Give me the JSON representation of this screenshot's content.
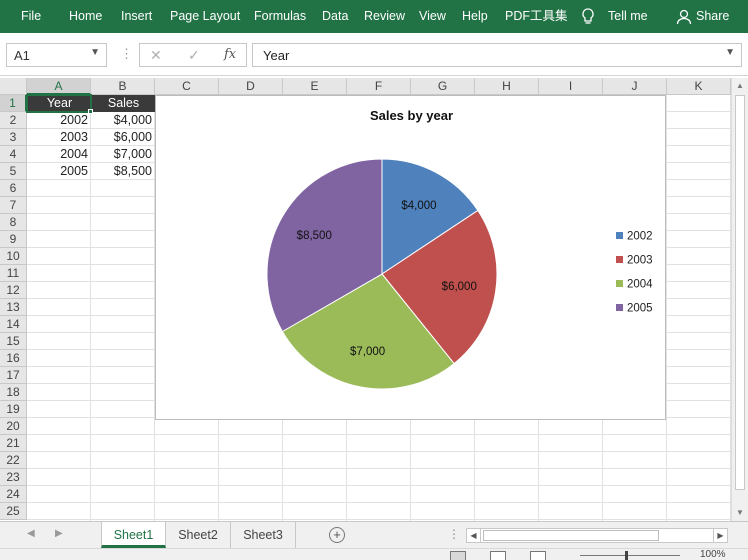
{
  "ribbon": {
    "menus": [
      "File",
      "Home",
      "Insert",
      "Page Layout",
      "Formulas",
      "Data",
      "Review",
      "View",
      "Help",
      "PDF工具集"
    ],
    "tell_me": "Tell me",
    "share": "Share"
  },
  "formula_bar": {
    "name_box": "A1",
    "formula_value": "Year"
  },
  "columns": [
    "A",
    "B",
    "C",
    "D",
    "E",
    "F",
    "G",
    "H",
    "I",
    "J",
    "K"
  ],
  "rows": [
    "1",
    "2",
    "3",
    "4",
    "5",
    "6",
    "7",
    "8",
    "9",
    "10",
    "11",
    "12",
    "13",
    "14",
    "15",
    "16",
    "17",
    "18",
    "19",
    "20",
    "21",
    "22",
    "23",
    "24",
    "25"
  ],
  "table": {
    "headers": [
      "Year",
      "Sales"
    ],
    "rows": [
      [
        "2002",
        "$4,000"
      ],
      [
        "2003",
        "$6,000"
      ],
      [
        "2004",
        "$7,000"
      ],
      [
        "2005",
        "$8,500"
      ]
    ]
  },
  "chart_data": {
    "type": "pie",
    "title": "Sales by year",
    "categories": [
      "2002",
      "2003",
      "2004",
      "2005"
    ],
    "values": [
      4000,
      6000,
      7000,
      8500
    ],
    "data_labels": [
      "$4,000",
      "$6,000",
      "$7,000",
      "$8,500"
    ],
    "colors": [
      "#4F81BD",
      "#C0504D",
      "#9BBB59",
      "#8064A2"
    ],
    "legend_position": "right"
  },
  "sheets": {
    "tabs": [
      "Sheet1",
      "Sheet2",
      "Sheet3"
    ],
    "active": "Sheet1"
  },
  "status": {
    "zoom": "100%"
  },
  "colors": {
    "ribbon": "#217346",
    "header_fill": "#3a3a3a"
  }
}
